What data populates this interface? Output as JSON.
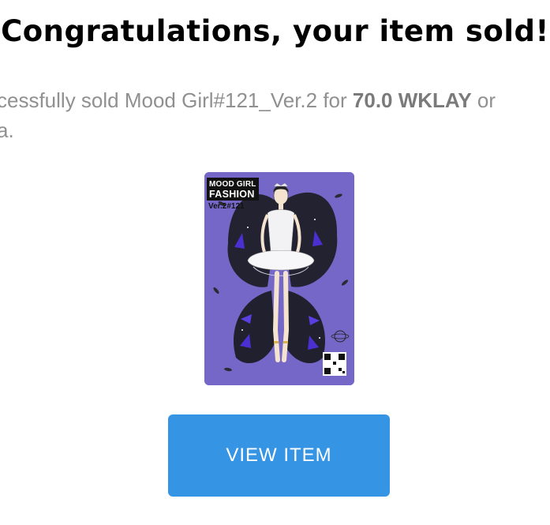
{
  "title": "Congratulations, your item sold!",
  "message": {
    "prefix": "cessfully sold Mood Girl#121_Ver.2 for ",
    "price": "70.0 WKLAY",
    "suffix": " or",
    "line2": "a."
  },
  "item_card": {
    "badge_line1": "MOOD GIRL",
    "badge_line2": "FASHION",
    "edition": "Ver.2#121"
  },
  "button": {
    "label": "VIEW ITEM"
  },
  "colors": {
    "button": "#3694e4",
    "card_background": "#7567c8",
    "message_text": "#909090"
  }
}
